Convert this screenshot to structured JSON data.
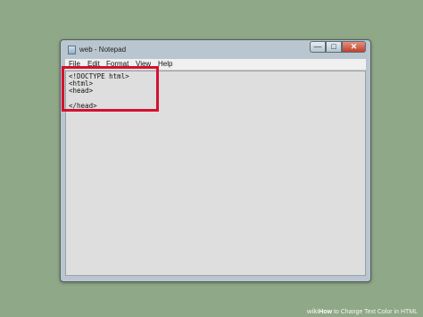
{
  "window": {
    "title": "web - Notepad",
    "controls": {
      "minimize": "—",
      "maximize": "□",
      "close": "✕"
    }
  },
  "menu": [
    "File",
    "Edit",
    "Format",
    "View",
    "Help"
  ],
  "editor": {
    "lines": [
      "<!DOCTYPE html>",
      "<html>",
      "<head>",
      "",
      "</head>"
    ]
  },
  "highlight_color": "#d5102f",
  "footer": {
    "brand": "wiki",
    "how": "How",
    "article_title": "to Change Text Color in HTML"
  },
  "icons": [
    "notepad-app-icon",
    "minimize-icon",
    "maximize-icon",
    "close-icon"
  ]
}
